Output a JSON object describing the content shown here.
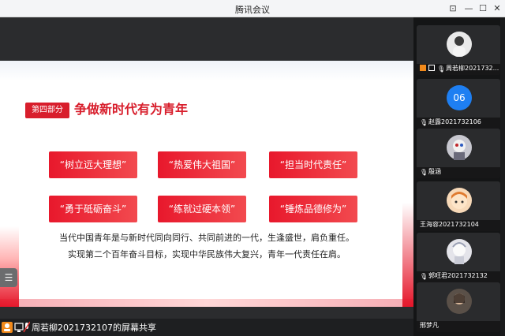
{
  "window": {
    "title": "腾讯会议"
  },
  "slide": {
    "section_badge": "第四部分",
    "heading": "争做新时代有为青年",
    "cards": [
      "“树立远大理想”",
      "“热爱伟大祖国”",
      "“担当时代责任”",
      "“勇于砥砺奋斗”",
      "“练就过硬本领”",
      "“锤炼品德修为”"
    ],
    "lines": [
      "当代中国青年是与新时代同向同行、共同前进的一代，生逢盛世，肩负重任。",
      "实现第二个百年奋斗目标，实现中华民族伟大复兴，青年一代责任在肩。"
    ]
  },
  "sharer": {
    "text": "周若柳2021732107的屏幕共享"
  },
  "participants": [
    {
      "name": "周若柳2021732...",
      "avatar": "photo"
    },
    {
      "name": "赵露2021732106",
      "avatar_text": "06",
      "avatar_color": "#1e7ff2"
    },
    {
      "name": "殷涵",
      "avatar": "photo"
    },
    {
      "name": "王海容2021732104",
      "avatar": "photo"
    },
    {
      "name": "郭旺君2021732132",
      "avatar": "photo"
    },
    {
      "name": "邢梦凡",
      "avatar": "photo"
    }
  ],
  "colors": {
    "accent_red": "#d81e2c"
  }
}
